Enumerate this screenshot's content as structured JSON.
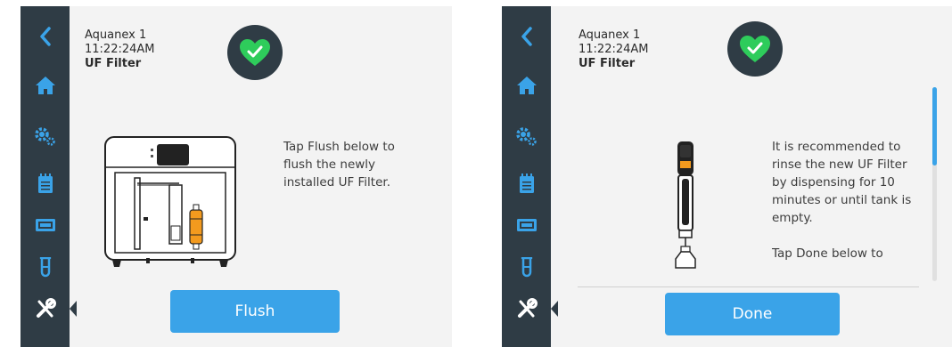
{
  "colors": {
    "sidebar": "#2f3c45",
    "accent": "#3aa3e8",
    "background": "#f3f3f3",
    "status_ok": "#2ecc5b"
  },
  "screens": [
    {
      "device_name": "Aquanex 1",
      "time": "11:22:24AM",
      "title": "UF Filter",
      "status_icon": "heart-check-icon",
      "instruction": "Tap Flush below to flush the newly installed UF Filter.",
      "illustration": "dispenser-with-uf-filter",
      "button_label": "Flush",
      "active_nav": "tools-icon"
    },
    {
      "device_name": "Aquanex 1",
      "time": "11:22:24AM",
      "title": "UF Filter",
      "status_icon": "heart-check-icon",
      "instruction": "It is recommended to rinse the new UF Filter by dispensing for 10 minutes or until tank is empty.\n\nTap Done below to",
      "illustration": "handheld-dispenser",
      "button_label": "Done",
      "active_nav": "tools-icon",
      "scroll_position_fraction": 0.0
    }
  ],
  "sidebar": {
    "items": [
      "back-icon",
      "home-icon",
      "settings-icon",
      "log-icon",
      "cartridge-icon",
      "sample-tube-icon",
      "tools-icon"
    ]
  }
}
